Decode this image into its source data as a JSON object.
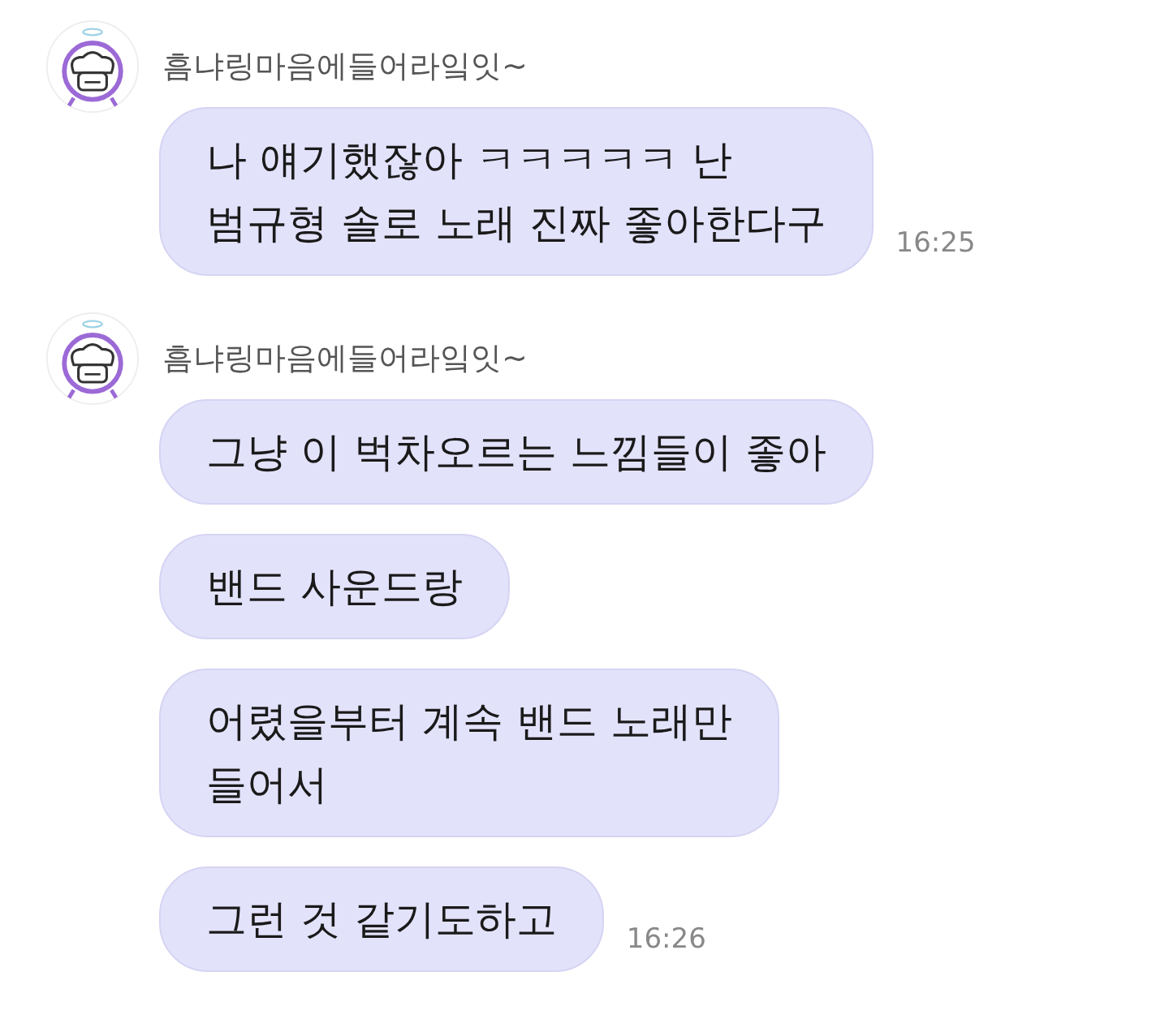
{
  "groups": [
    {
      "sender": "흠냐링마음에들어라잌잇~",
      "messages": [
        {
          "text": "나 얘기했잖아 ㅋㅋㅋㅋㅋ 난\n범규형 솔로 노래 진짜 좋아한다구",
          "time": "16:25"
        }
      ]
    },
    {
      "sender": "흠냐링마음에들어라잌잇~",
      "messages": [
        {
          "text": "그냥 이 벅차오르는 느낌들이 좋아"
        },
        {
          "text": "밴드 사운드랑"
        },
        {
          "text": "어렸을부터 계속 밴드 노래만\n들어서"
        },
        {
          "text": "그런 것 같기도하고",
          "time": "16:26"
        }
      ]
    }
  ]
}
